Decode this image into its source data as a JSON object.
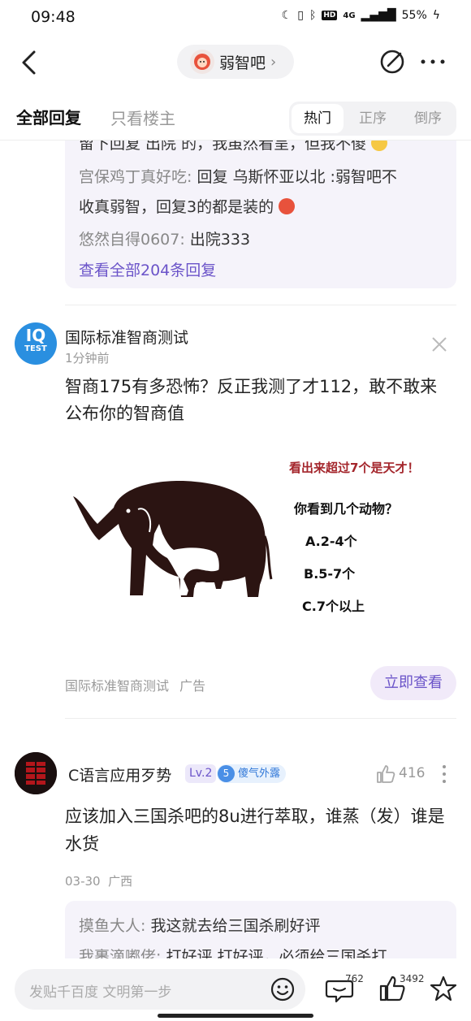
{
  "status_bar": {
    "time": "09:48",
    "battery": "55%",
    "network": "4G"
  },
  "header": {
    "forum_name": "弱智吧"
  },
  "tabs": {
    "all_replies": "全部回复",
    "op_only": "只看楼主",
    "sort": [
      "热门",
      "正序",
      "倒序"
    ]
  },
  "reply_box_top": {
    "partial_line": "留下回复 出院 的，我虽然看呈，但我不傻",
    "line1_user": "宫保鸡丁真好吃:",
    "line1_text": " 回复 乌斯怀亚以北 :弱智吧不",
    "line2_text": "收真弱智，回复3的都是装的",
    "line3_user": "悠然自得0607:",
    "line3_text": " 出院333",
    "view_all": "查看全部204条回复"
  },
  "ad": {
    "logo_top": "IQ",
    "logo_bottom": "TEST",
    "name": "国际标准智商测试",
    "time": "1分钟前",
    "text": "智商175有多恐怖？反正我测了才112，敢不敢来公布你的智商值",
    "image": {
      "headline": "看出来超过7个是天才！",
      "question": "你看到几个动物？",
      "options": [
        "A.2-4个",
        "B.5-7个",
        "C.7个以上"
      ]
    },
    "source": "国际标准智商测试",
    "tag": "广告",
    "cta": "立即查看"
  },
  "comment": {
    "user": "C语言应用歹势",
    "level": "Lv.2",
    "badge_num": "5",
    "badge_text": "傻气外露",
    "likes": "416",
    "text": "应该加入三国杀吧的8u进行萃取，谁蒸（发）谁是水货",
    "date": "03-30",
    "location": "广西",
    "replies": [
      {
        "user": "摸鱼大人:",
        "text": " 我这就去给三国杀刷好评"
      },
      {
        "user": "我裹滴嘟佬:",
        "text": " 打好评  打好评，必须给三国杀打"
      }
    ]
  },
  "bottom_bar": {
    "placeholder": "发贴千百度 文明第一步",
    "comments_count": "762",
    "likes_count": "3492"
  },
  "colors": {
    "accent": "#6b54c9",
    "reply_bg": "#f5f3fa",
    "iq_blue": "#2a8fe0",
    "ad_headline": "#a4262c"
  }
}
